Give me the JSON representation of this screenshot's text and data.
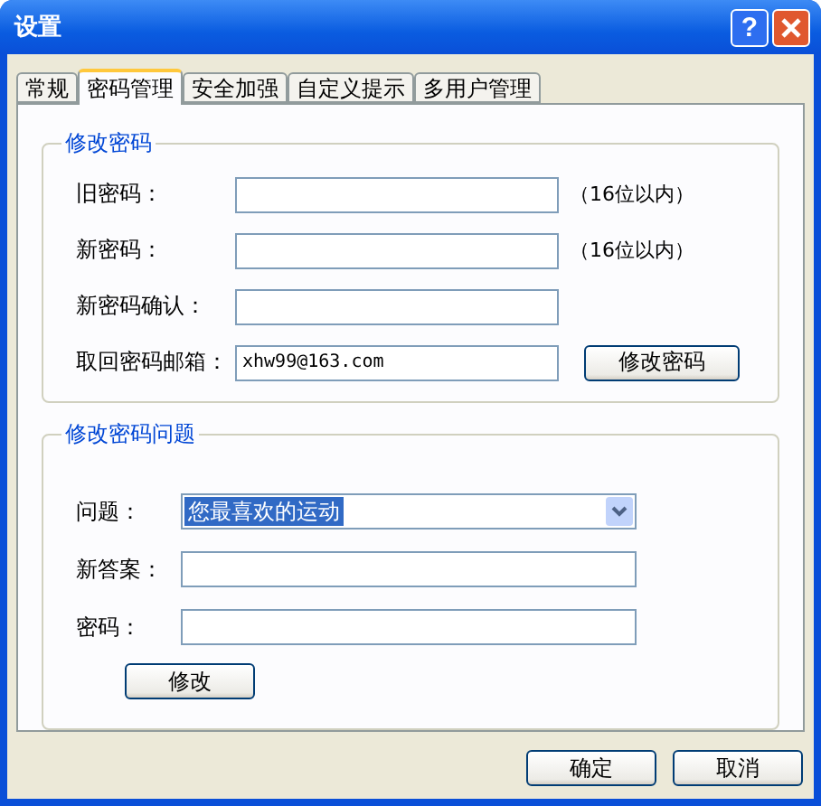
{
  "window": {
    "title": "设置",
    "help_button": "?"
  },
  "tabs": [
    {
      "label": "常规",
      "selected": false
    },
    {
      "label": "密码管理",
      "selected": true
    },
    {
      "label": "安全加强",
      "selected": false
    },
    {
      "label": "自定义提示",
      "selected": false
    },
    {
      "label": "多用户管理",
      "selected": false
    }
  ],
  "change_password": {
    "title": "修改密码",
    "fields": [
      {
        "label": "旧密码：",
        "hint": "（16位以内）"
      },
      {
        "label": "新密码：",
        "hint": "（16位以内）"
      },
      {
        "label": "新密码确认："
      },
      {
        "label": "取回密码邮箱：",
        "value": "xhw99@163.com"
      }
    ],
    "button": "修改密码"
  },
  "change_question": {
    "title": "修改密码问题",
    "fields": [
      {
        "label": "问题：",
        "kind": "select",
        "value": "您最喜欢的运动"
      },
      {
        "label": "新答案：",
        "kind": "text"
      },
      {
        "label": "密码：",
        "kind": "text"
      }
    ],
    "button": "修改"
  },
  "buttons": [
    "确定",
    "取消"
  ]
}
